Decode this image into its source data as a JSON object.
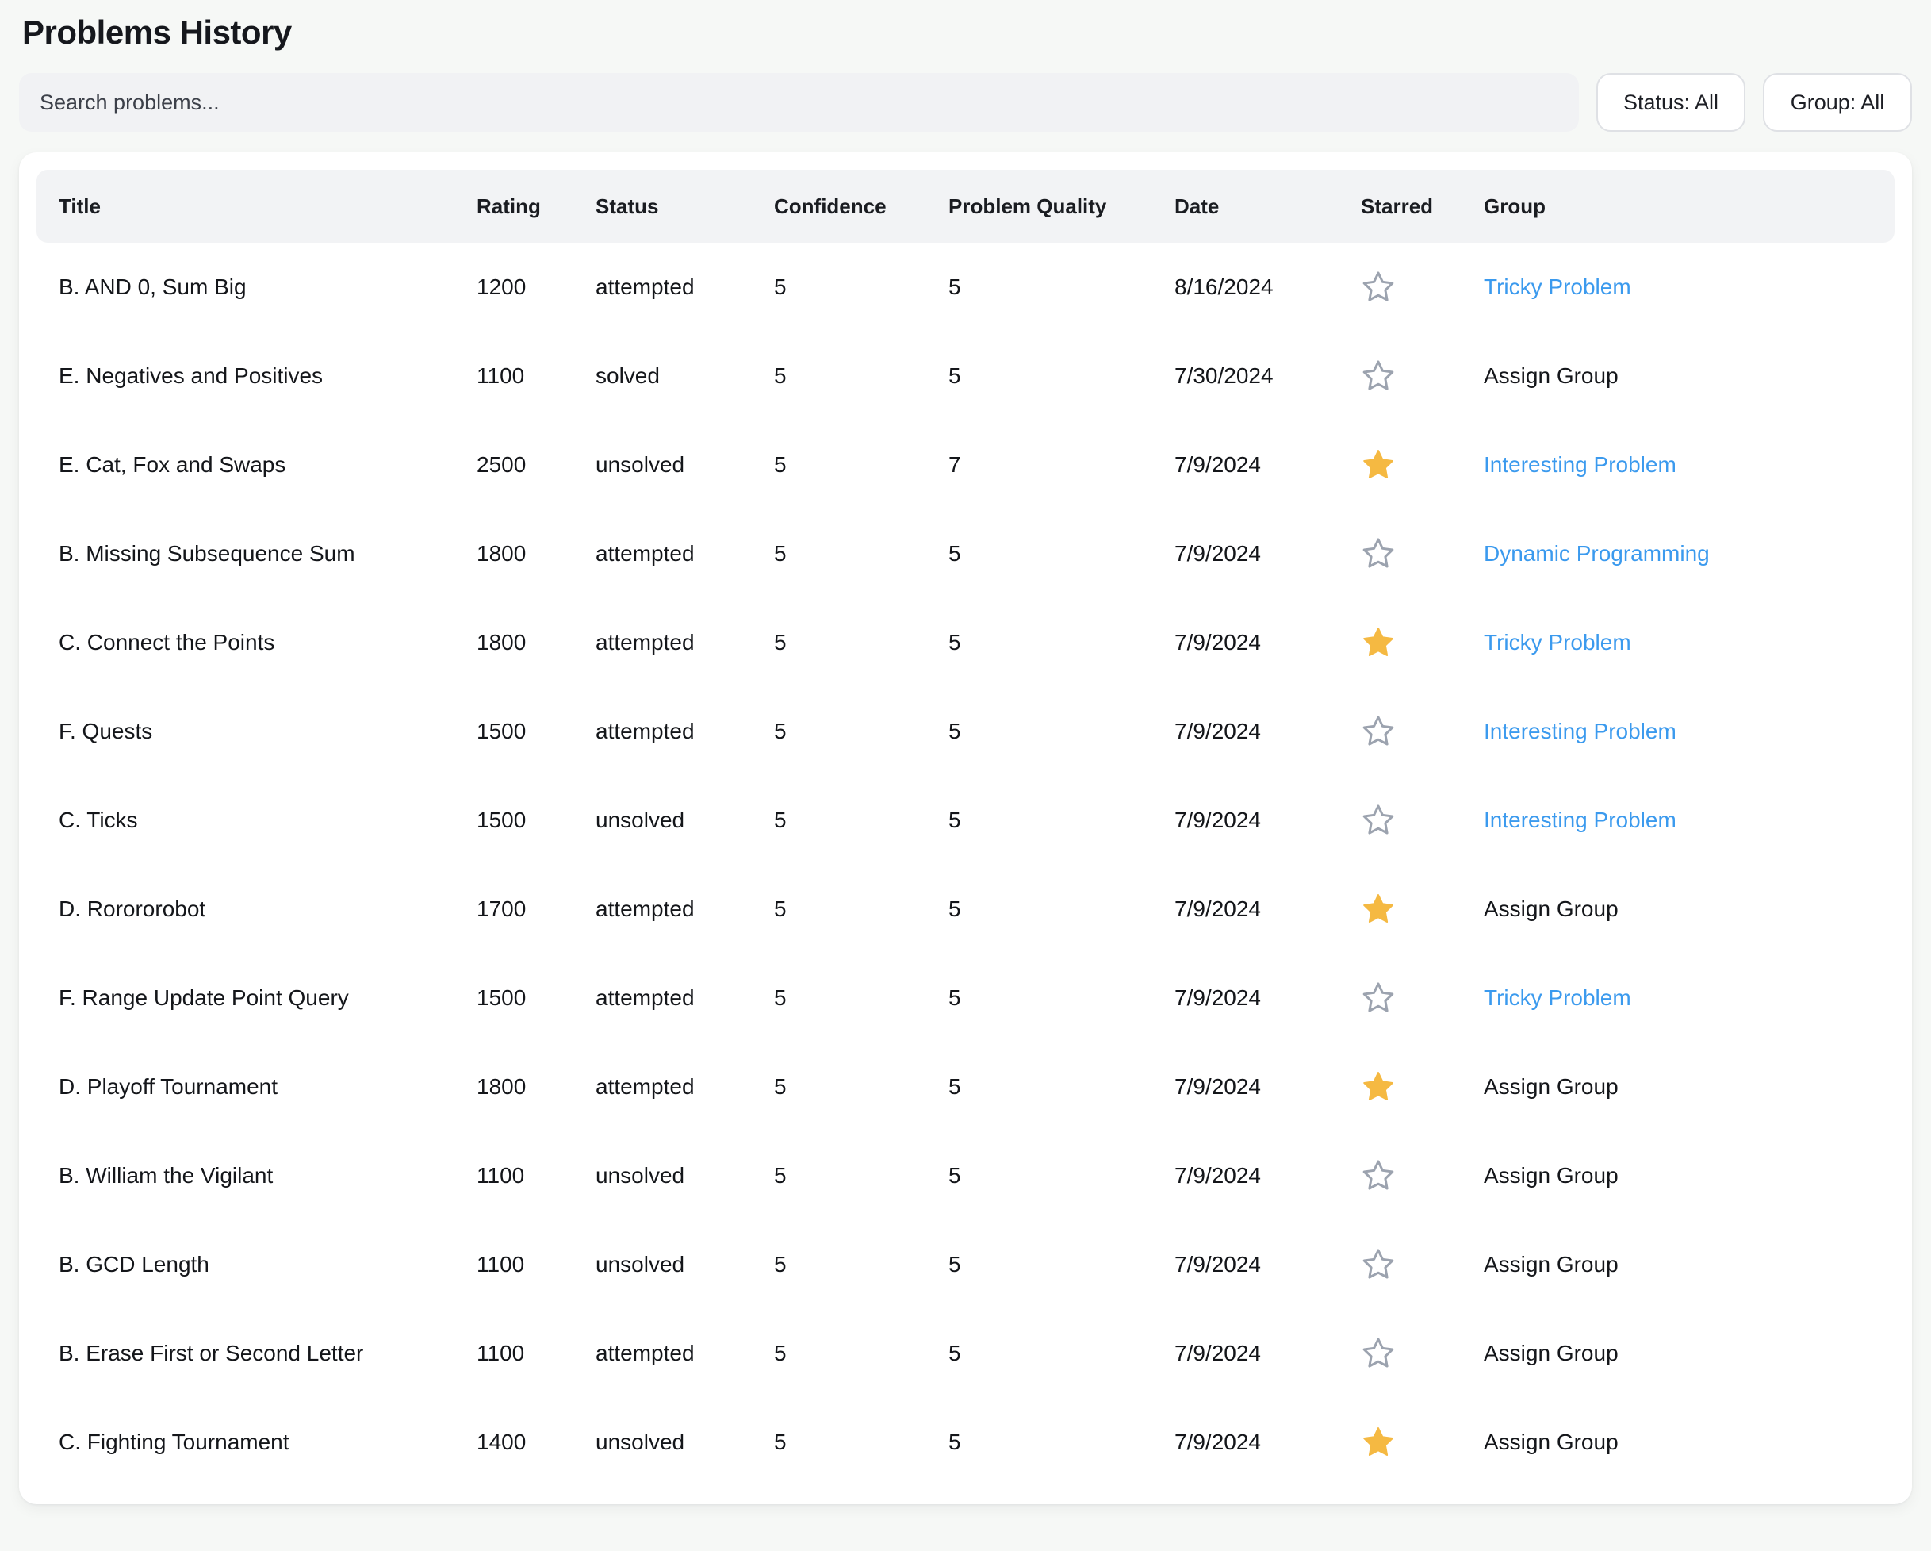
{
  "header": {
    "title": "Problems History"
  },
  "search": {
    "value": "",
    "placeholder": "Search problems..."
  },
  "filters": {
    "status_label": "Status: All",
    "group_label": "Group: All"
  },
  "colors": {
    "link": "#3b9aee",
    "star_filled": "#f5b942",
    "star_empty_outline": "#9ca3af",
    "page_background": "#f6f8f6",
    "card_background": "#ffffff",
    "header_row_background": "#f2f3f5"
  },
  "table": {
    "columns": [
      "Title",
      "Rating",
      "Status",
      "Confidence",
      "Problem Quality",
      "Date",
      "Starred",
      "Group"
    ],
    "rows": [
      {
        "title": "B. AND 0, Sum Big",
        "rating": "1200",
        "status": "attempted",
        "confidence": "5",
        "quality": "5",
        "date": "8/16/2024",
        "starred": false,
        "group": "Tricky Problem",
        "group_assigned": true
      },
      {
        "title": "E. Negatives and Positives",
        "rating": "1100",
        "status": "solved",
        "confidence": "5",
        "quality": "5",
        "date": "7/30/2024",
        "starred": false,
        "group": "Assign Group",
        "group_assigned": false
      },
      {
        "title": "E. Cat, Fox and Swaps",
        "rating": "2500",
        "status": "unsolved",
        "confidence": "5",
        "quality": "7",
        "date": "7/9/2024",
        "starred": true,
        "group": "Interesting Problem",
        "group_assigned": true
      },
      {
        "title": "B. Missing Subsequence Sum",
        "rating": "1800",
        "status": "attempted",
        "confidence": "5",
        "quality": "5",
        "date": "7/9/2024",
        "starred": false,
        "group": "Dynamic Programming",
        "group_assigned": true
      },
      {
        "title": "C. Connect the Points",
        "rating": "1800",
        "status": "attempted",
        "confidence": "5",
        "quality": "5",
        "date": "7/9/2024",
        "starred": true,
        "group": "Tricky Problem",
        "group_assigned": true
      },
      {
        "title": "F. Quests",
        "rating": "1500",
        "status": "attempted",
        "confidence": "5",
        "quality": "5",
        "date": "7/9/2024",
        "starred": false,
        "group": "Interesting Problem",
        "group_assigned": true
      },
      {
        "title": "C. Ticks",
        "rating": "1500",
        "status": "unsolved",
        "confidence": "5",
        "quality": "5",
        "date": "7/9/2024",
        "starred": false,
        "group": "Interesting Problem",
        "group_assigned": true
      },
      {
        "title": "D. Rorororobot",
        "rating": "1700",
        "status": "attempted",
        "confidence": "5",
        "quality": "5",
        "date": "7/9/2024",
        "starred": true,
        "group": "Assign Group",
        "group_assigned": false
      },
      {
        "title": "F. Range Update Point Query",
        "rating": "1500",
        "status": "attempted",
        "confidence": "5",
        "quality": "5",
        "date": "7/9/2024",
        "starred": false,
        "group": "Tricky Problem",
        "group_assigned": true
      },
      {
        "title": "D. Playoff Tournament",
        "rating": "1800",
        "status": "attempted",
        "confidence": "5",
        "quality": "5",
        "date": "7/9/2024",
        "starred": true,
        "group": "Assign Group",
        "group_assigned": false
      },
      {
        "title": "B. William the Vigilant",
        "rating": "1100",
        "status": "unsolved",
        "confidence": "5",
        "quality": "5",
        "date": "7/9/2024",
        "starred": false,
        "group": "Assign Group",
        "group_assigned": false
      },
      {
        "title": "B. GCD Length",
        "rating": "1100",
        "status": "unsolved",
        "confidence": "5",
        "quality": "5",
        "date": "7/9/2024",
        "starred": false,
        "group": "Assign Group",
        "group_assigned": false
      },
      {
        "title": "B. Erase First or Second Letter",
        "rating": "1100",
        "status": "attempted",
        "confidence": "5",
        "quality": "5",
        "date": "7/9/2024",
        "starred": false,
        "group": "Assign Group",
        "group_assigned": false
      },
      {
        "title": "C. Fighting Tournament",
        "rating": "1400",
        "status": "unsolved",
        "confidence": "5",
        "quality": "5",
        "date": "7/9/2024",
        "starred": true,
        "group": "Assign Group",
        "group_assigned": false
      }
    ]
  },
  "icons": {
    "star_filled": "star-filled-icon",
    "star_empty": "star-outline-icon"
  }
}
